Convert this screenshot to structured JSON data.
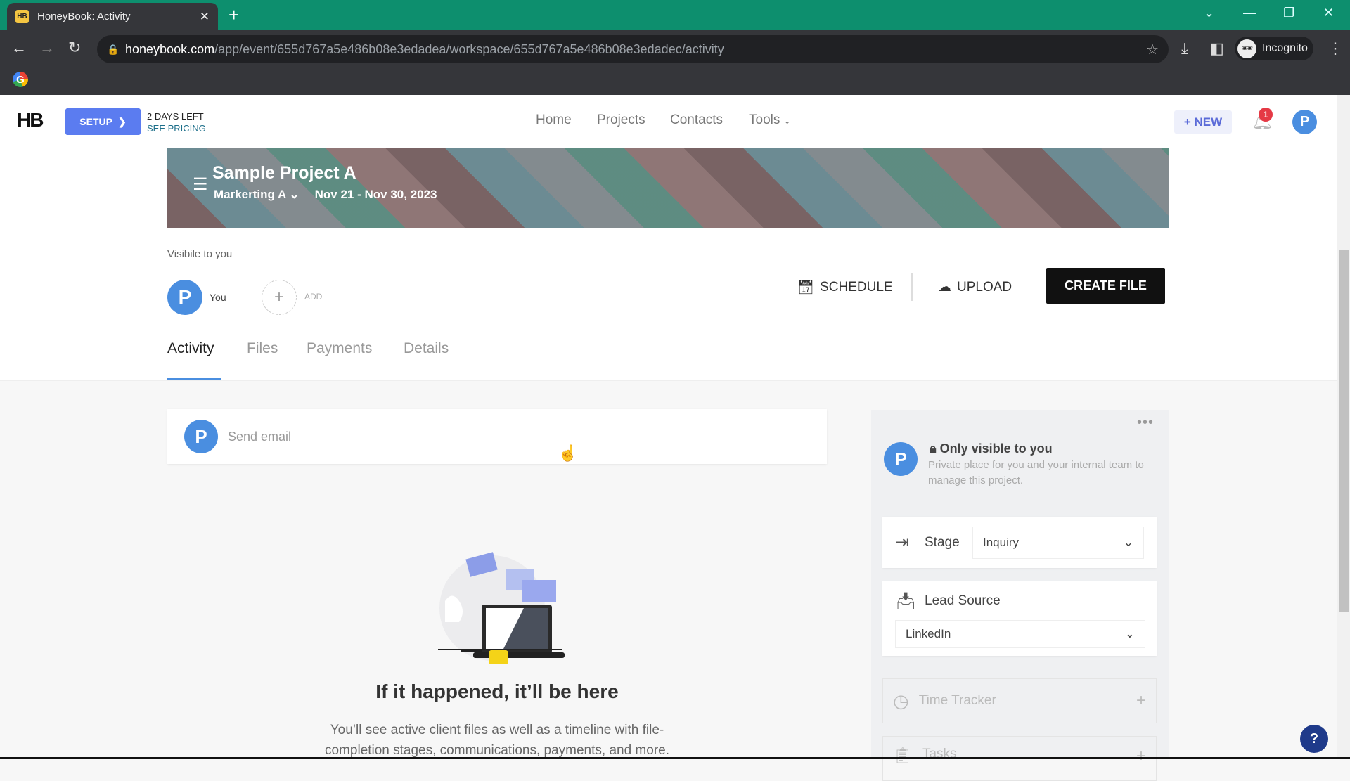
{
  "browser": {
    "tab_title": "HoneyBook: Activity",
    "favicon": "HB",
    "url_host": "honeybook.com",
    "url_path": "/app/event/655d767a5e486b08e3edadea/workspace/655d767a5e486b08e3edadec/activity",
    "profile": "Incognito"
  },
  "header": {
    "logo": "HB",
    "setup_label": "SETUP",
    "trial": "2 DAYS LEFT",
    "pricing": "SEE PRICING",
    "nav": [
      "Home",
      "Projects",
      "Contacts",
      "Tools"
    ],
    "new_label": "+ NEW",
    "notifications": "1",
    "avatar": "P"
  },
  "project": {
    "title": "Sample Project A",
    "type": "Markerting A",
    "dates": "Nov 21 - Nov 30, 2023"
  },
  "visibility": {
    "label": "Visibile to you",
    "member": "You",
    "avatar": "P",
    "add": "ADD"
  },
  "actions": {
    "schedule": "SCHEDULE",
    "upload": "UPLOAD",
    "create": "CREATE FILE"
  },
  "tabs": [
    "Activity",
    "Files",
    "Payments",
    "Details"
  ],
  "composer": {
    "avatar": "P",
    "placeholder": "Send email"
  },
  "empty": {
    "title": "If it happened, it’ll be here",
    "text1": "You’ll see active client files as well as a timeline with file-",
    "text2": "completion stages, communications, payments, and more."
  },
  "panel": {
    "avatar": "P",
    "title": "Only visible to you",
    "text": "Private place for you and your internal team to manage this project.",
    "stage_label": "Stage",
    "stage_value": "Inquiry",
    "lead_label": "Lead Source",
    "lead_value": "LinkedIn",
    "time_tracker": "Time Tracker",
    "tasks": "Tasks"
  },
  "colors": {
    "accent": "#4a8ee0",
    "setup": "#5b7cf0",
    "chrome_frame": "#0d8f6e"
  }
}
